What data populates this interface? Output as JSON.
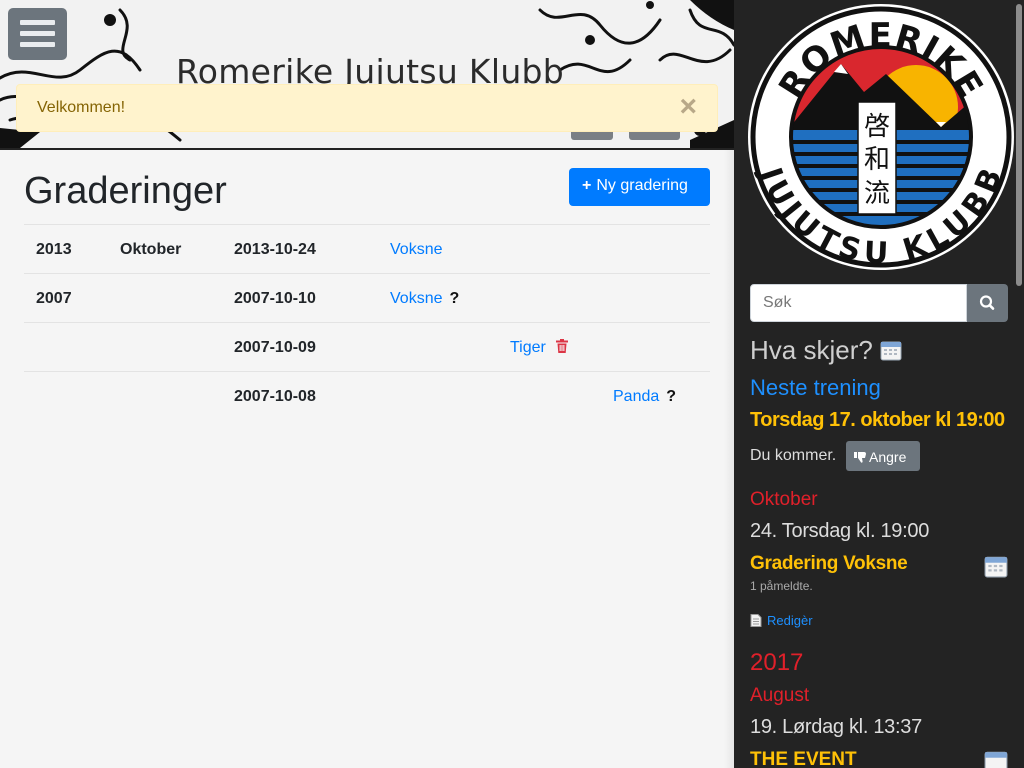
{
  "header": {
    "site_title": "Romerike Jujutsu Klubb",
    "menu_icon": "hamburger-menu-icon"
  },
  "alert": {
    "message": "Velkommen!",
    "close_label": "×"
  },
  "main": {
    "title": "Graderinger",
    "new_button_label": "Ny gradering",
    "new_button_icon": "plus-icon",
    "rows": [
      {
        "year": "2013",
        "month": "Oktober",
        "date": "2013-10-24",
        "group": "Voksne",
        "group_col": 1,
        "marker": ""
      },
      {
        "year": "2007",
        "month": "",
        "date": "2007-10-10",
        "group": "Voksne",
        "group_col": 1,
        "marker": "?"
      },
      {
        "year": "",
        "month": "",
        "date": "2007-10-09",
        "group": "Tiger",
        "group_col": 2,
        "marker": "trash-icon"
      },
      {
        "year": "",
        "month": "",
        "date": "2007-10-08",
        "group": "Panda",
        "group_col": 3,
        "marker": "?"
      }
    ]
  },
  "sidebar": {
    "logo": {
      "top_text": "ROMERIKE",
      "bottom_text": "JUJUTSU KLUBB",
      "kanji": [
        "啓",
        "和",
        "流"
      ]
    },
    "search": {
      "placeholder": "Søk",
      "button_icon": "search-icon"
    },
    "whats_up": "Hva skjer?",
    "next_training_label": "Neste trening",
    "next_training_date": "Torsdag 17. oktober kl 19:00",
    "attending_text": "Du kommer.",
    "undo_label": "Angre",
    "undo_icon": "thumbs-down-icon",
    "events": [
      {
        "month": "Oktober",
        "date": "24. Torsdag kl. 19:00",
        "title": "Gradering Voksne",
        "subtitle": "1 påmeldte.",
        "edit_label": "Redigèr"
      },
      {
        "year": "2017",
        "month": "August",
        "date": "19. Lørdag kl. 13:37",
        "title": "THE EVENT"
      }
    ]
  },
  "colors": {
    "primary": "#007bff",
    "sidebar_bg": "#232323",
    "accent_yellow": "#ffc107",
    "accent_red": "#e0202a",
    "alert_bg": "#fff3cd"
  }
}
